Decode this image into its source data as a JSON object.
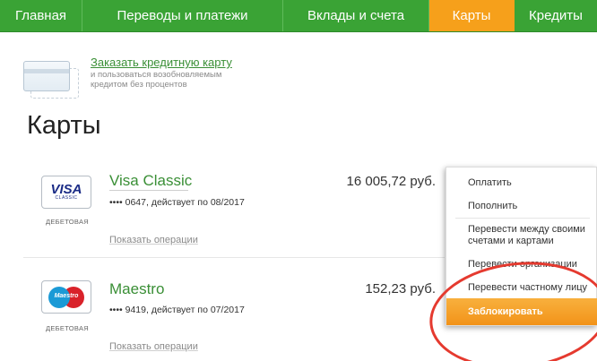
{
  "nav": {
    "items": [
      {
        "label": "Главная"
      },
      {
        "label": "Переводы и платежи"
      },
      {
        "label": "Вклады и счета"
      },
      {
        "label": "Карты"
      },
      {
        "label": "Кредиты"
      }
    ],
    "active_index": 3
  },
  "promo": {
    "link": "Заказать кредитную карту",
    "description": "и пользоваться возобновляемым кредитом без процентов"
  },
  "page_title": "Карты",
  "cards": [
    {
      "logo": "VISA",
      "logo_sub": "CLASSIC",
      "type": "ДЕБЕТОВАЯ",
      "name": "Visa Classic",
      "info": "•••• 0647, действует по 08/2017",
      "balance": "16 005,72 руб.",
      "ops_link": "Показать операции"
    },
    {
      "logo": "Maestro",
      "type": "ДЕБЕТОВАЯ",
      "name": "Maestro",
      "info": "•••• 9419, действует по 07/2017",
      "balance": "152,23 руб.",
      "ops_link": "Показать операции"
    }
  ],
  "menu": {
    "items": [
      {
        "label": "Оплатить"
      },
      {
        "label": "Пополнить"
      },
      {
        "label": "Перевести между своими счетами и картами"
      },
      {
        "label": "Перевести организации"
      },
      {
        "label": "Перевести частному лицу"
      },
      {
        "label": "Заблокировать"
      }
    ]
  },
  "colors": {
    "nav_green": "#3aa335",
    "nav_active": "#f6a01b",
    "link_green": "#3a8f36",
    "highlight_orange": "#f29319",
    "annotation_red": "#e53a2f"
  }
}
